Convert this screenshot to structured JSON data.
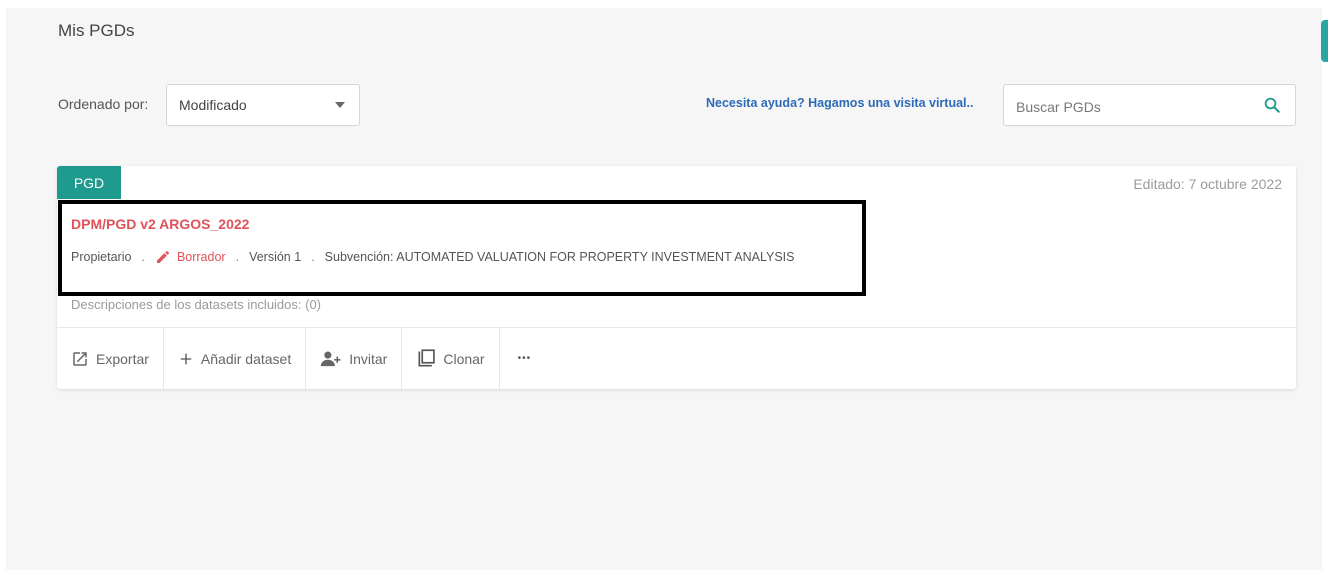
{
  "page": {
    "title": "Mis PGDs"
  },
  "toolbar": {
    "sort_label": "Ordenado por:",
    "sort_selected": "Modificado",
    "help_link": "Necesita ayuda? Hagamos una visita virtual..",
    "search_placeholder": "Buscar PGDs"
  },
  "card": {
    "badge": "PGD",
    "edited": "Editado: 7 octubre 2022",
    "title": "DPM/PGD v2 ARGOS_2022",
    "meta": {
      "role": "Propietario",
      "status": "Borrador",
      "version": "Versión 1",
      "grant": "Subvención: AUTOMATED VALUATION FOR PROPERTY INVESTMENT ANALYSIS",
      "separator": "."
    },
    "description": "Descripciones de los datasets incluidos: (0)",
    "actions": {
      "export": "Exportar",
      "add_dataset": "Añadir dataset",
      "invite": "Invitar",
      "clone": "Clonar",
      "more": "•••"
    }
  },
  "colors": {
    "accent_teal": "#1e9a8f",
    "title_red": "#e0525a",
    "link_blue": "#2d6ab8"
  }
}
